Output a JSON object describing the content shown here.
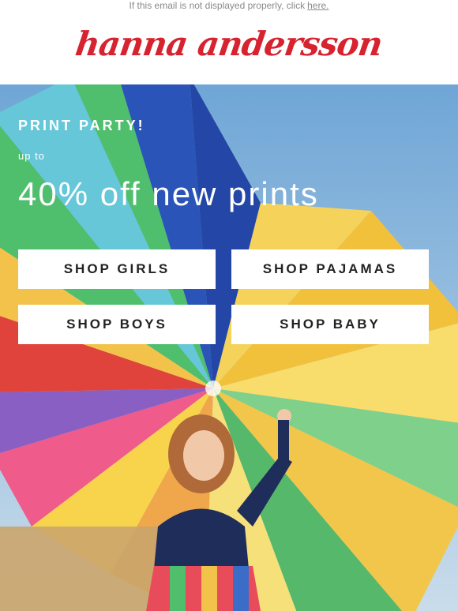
{
  "preheader": {
    "text": "If this email is not displayed properly, click",
    "link": "here."
  },
  "brand": {
    "logo_text": "hanna andersson",
    "color": "#d7232f"
  },
  "hero": {
    "eyebrow": "PRINT PARTY!",
    "upto": "up to",
    "headline": "40% off new prints"
  },
  "buttons": {
    "girls": "SHOP GIRLS",
    "pajamas": "SHOP PAJAMAS",
    "boys": "SHOP BOYS",
    "baby": "SHOP BABY"
  }
}
